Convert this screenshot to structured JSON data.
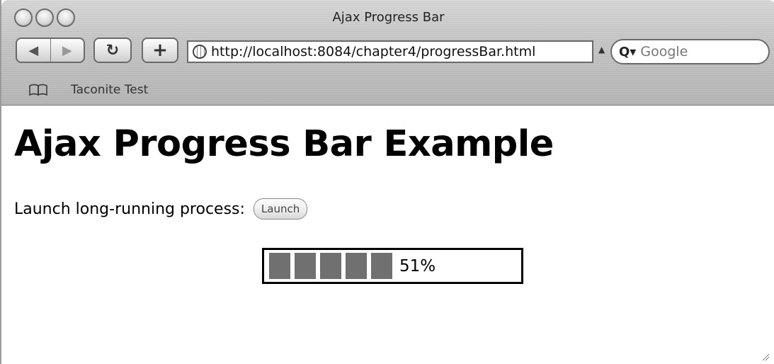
{
  "window": {
    "title": "Ajax Progress Bar"
  },
  "toolbar": {
    "back_symbol": "◀",
    "forward_symbol": "▶",
    "reload_symbol": "↻",
    "add_symbol": "+",
    "url": "http://localhost:8084/chapter4/progressBar.html",
    "search_placeholder": "Google",
    "search_icon_text": "Q▾"
  },
  "bookmarks_bar": {
    "items": [
      {
        "label": "Taconite Test"
      }
    ]
  },
  "page": {
    "heading": "Ajax Progress Bar Example",
    "launch_label": "Launch long-running process:",
    "launch_button": "Launch",
    "progress": {
      "percent": 51,
      "label": "51%",
      "filled_blocks": 5
    }
  },
  "colors": {
    "progress_block": "#707070",
    "chrome": "#c4c4c4"
  }
}
